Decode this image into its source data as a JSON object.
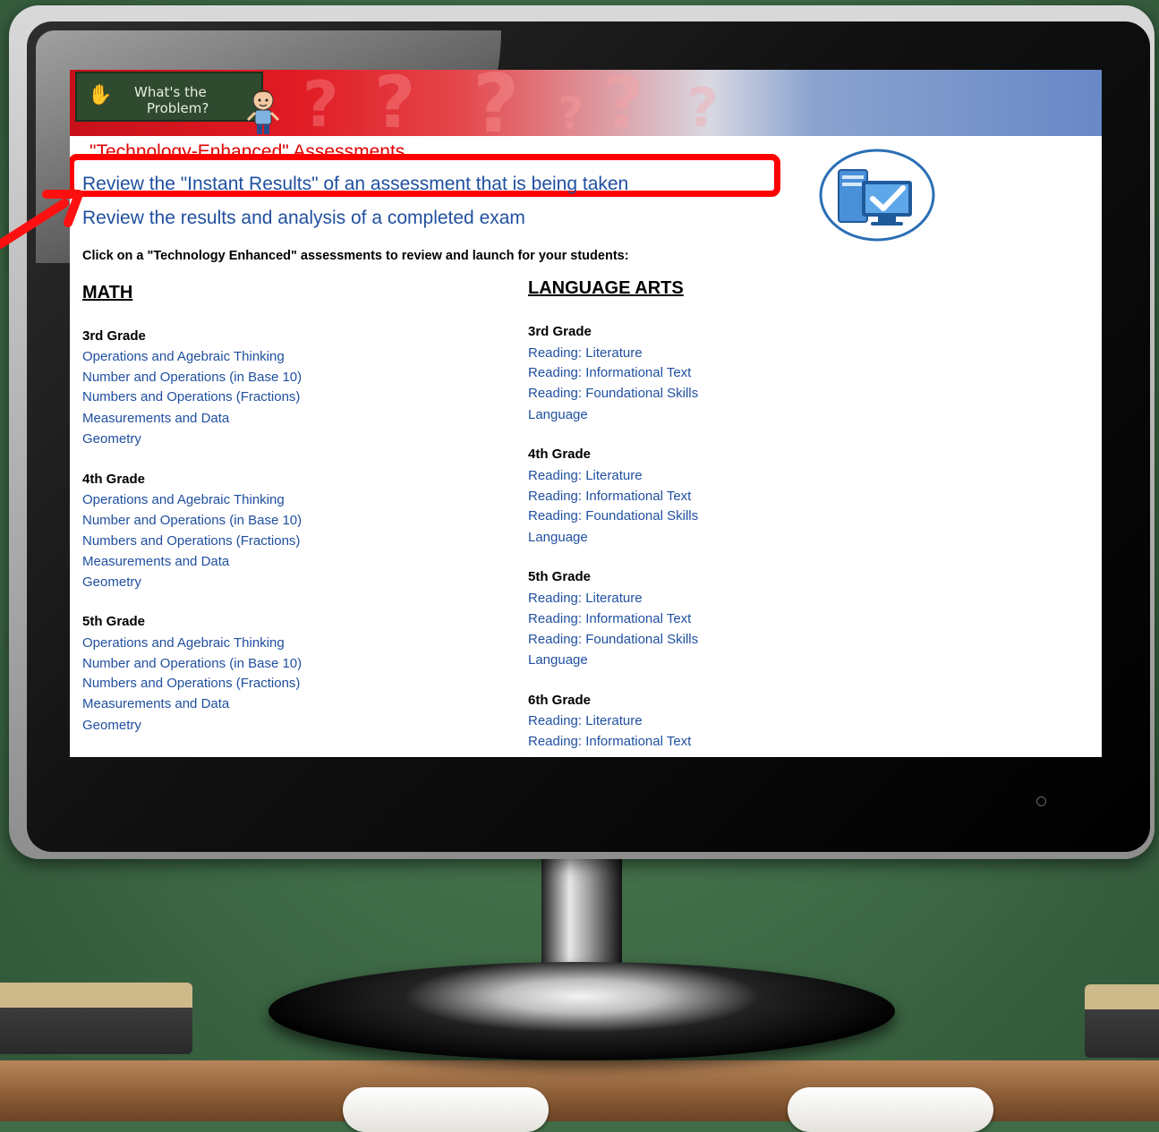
{
  "banner": {
    "logo_line1": "What's the",
    "logo_line2": "Problem?",
    "question_marks": [
      "?",
      "?",
      "?",
      "?",
      "?",
      "?"
    ]
  },
  "page": {
    "heading": "\"Technology-Enhanced\" Assessments",
    "link_instant": "Review the \"Instant Results\" of an assessment that is being taken",
    "link_completed": "Review the results and analysis of a completed exam",
    "instructions": "Click on a \"Technology Enhanced\" assessments to review and launch for your students:"
  },
  "math": {
    "title": "MATH",
    "grades": [
      {
        "name": "3rd Grade",
        "topics": [
          "Operations and Agebraic Thinking",
          "Number and Operations (in Base 10)",
          "Numbers and Operations (Fractions)",
          "Measurements and Data",
          "Geometry"
        ]
      },
      {
        "name": "4th Grade",
        "topics": [
          "Operations and Agebraic Thinking",
          "Number and Operations (in Base 10)",
          "Numbers and Operations (Fractions)",
          "Measurements and Data",
          "Geometry"
        ]
      },
      {
        "name": "5th Grade",
        "topics": [
          "Operations and Agebraic Thinking",
          "Number and Operations (in Base 10)",
          "Numbers and Operations (Fractions)",
          "Measurements and Data",
          "Geometry"
        ]
      }
    ]
  },
  "language_arts": {
    "title": "LANGUAGE ARTS",
    "grades": [
      {
        "name": "3rd Grade",
        "topics": [
          "Reading: Literature",
          "Reading: Informational Text",
          "Reading: Foundational Skills",
          "Language"
        ]
      },
      {
        "name": "4th Grade",
        "topics": [
          "Reading: Literature",
          "Reading: Informational Text",
          "Reading: Foundational Skills",
          "Language"
        ]
      },
      {
        "name": "5th Grade",
        "topics": [
          "Reading: Literature",
          "Reading: Informational Text",
          "Reading: Foundational Skills",
          "Language"
        ]
      },
      {
        "name": "6th Grade",
        "topics": [
          "Reading: Literature",
          "Reading: Informational Text"
        ]
      }
    ]
  },
  "colors": {
    "link": "#1f4f9f",
    "highlight": "#ff0000",
    "heading": "#e00000"
  }
}
